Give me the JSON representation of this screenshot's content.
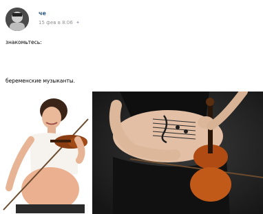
{
  "post": {
    "author": "че",
    "date": "15 фев в 8:06",
    "text_line1": "знакомьтесь:",
    "text_line2": "беременские музыканты.",
    "avatar_icon": "user-avatar-icon",
    "pin_icon": "pin-icon"
  },
  "colors": {
    "author_link": "#2a5885",
    "meta_gray": "#939393",
    "right_photo_background": "#2b2b2b"
  }
}
